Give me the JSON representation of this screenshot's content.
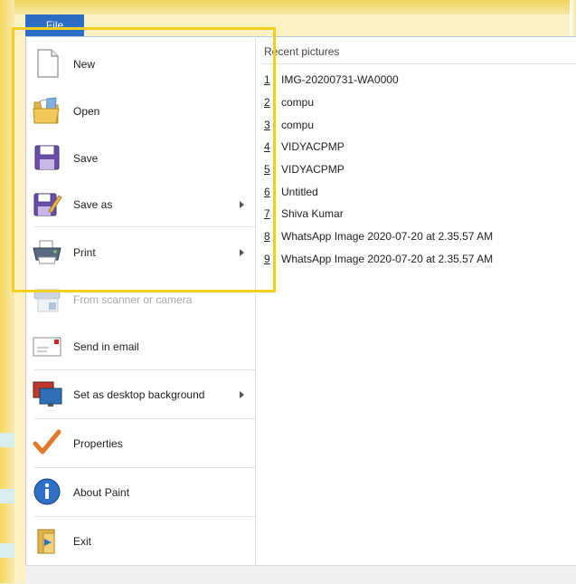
{
  "file_tab": {
    "label": "File"
  },
  "menu": {
    "items": [
      {
        "label": "New",
        "icon": "new-document-icon",
        "disabled": false,
        "submenu": false
      },
      {
        "label": "Open",
        "icon": "open-folder-icon",
        "disabled": false,
        "submenu": false
      },
      {
        "label": "Save",
        "icon": "save-floppy-icon",
        "disabled": false,
        "submenu": false
      },
      {
        "label": "Save as",
        "icon": "save-as-icon",
        "disabled": false,
        "submenu": true
      },
      {
        "label": "Print",
        "icon": "printer-icon",
        "disabled": false,
        "submenu": true
      },
      {
        "label": "From scanner or camera",
        "icon": "scanner-icon",
        "disabled": true,
        "submenu": false
      },
      {
        "label": "Send in email",
        "icon": "email-icon",
        "disabled": false,
        "submenu": false
      },
      {
        "label": "Set as desktop background",
        "icon": "desktop-background-icon",
        "disabled": false,
        "submenu": true
      },
      {
        "label": "Properties",
        "icon": "checkmark-icon",
        "disabled": false,
        "submenu": false
      },
      {
        "label": "About Paint",
        "icon": "info-icon",
        "disabled": false,
        "submenu": false
      },
      {
        "label": "Exit",
        "icon": "exit-icon",
        "disabled": false,
        "submenu": false
      }
    ]
  },
  "recent": {
    "header": "Recent pictures",
    "items": [
      {
        "num": "1",
        "name": "IMG-20200731-WA0000"
      },
      {
        "num": "2",
        "name": "compu"
      },
      {
        "num": "3",
        "name": "compu"
      },
      {
        "num": "4",
        "name": "VIDYACPMP"
      },
      {
        "num": "5",
        "name": "VIDYACPMP"
      },
      {
        "num": "6",
        "name": "Untitled"
      },
      {
        "num": "7",
        "name": "Shiva Kumar"
      },
      {
        "num": "8",
        "name": "WhatsApp Image 2020-07-20 at 2.35.57 AM"
      },
      {
        "num": "9",
        "name": "WhatsApp Image 2020-07-20 at 2.35.57 AM"
      }
    ]
  },
  "colors": {
    "file_tab": "#2b6cc4",
    "highlight": "#f5cf1e",
    "disabled_text": "#a8a8a8"
  }
}
